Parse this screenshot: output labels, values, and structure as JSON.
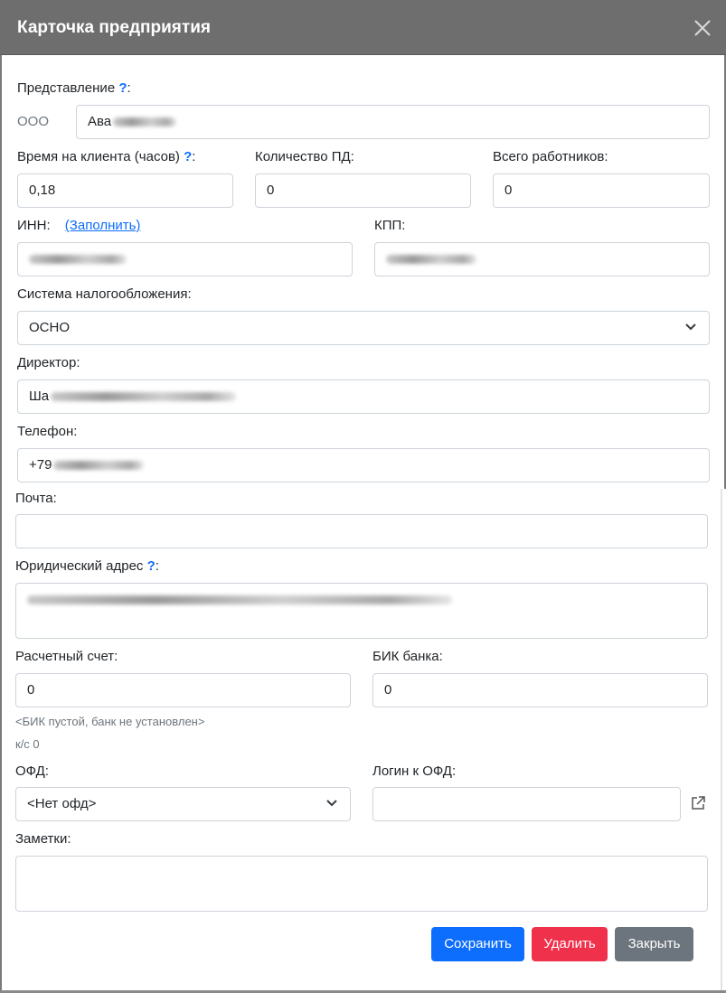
{
  "modal": {
    "title": "Карточка предприятия"
  },
  "fields": {
    "representation": {
      "label": "Представление",
      "help": "?",
      "colon": ":",
      "prefix": "ООО",
      "value": "Ава"
    },
    "client_time": {
      "label": "Время на клиента (часов)",
      "help": "?",
      "colon": ":",
      "value": "0,18"
    },
    "pd_count": {
      "label": "Количество ПД:",
      "value": "0"
    },
    "workers": {
      "label": "Всего работников:",
      "value": "0"
    },
    "inn": {
      "label": "ИНН:",
      "fill_link": "(Заполнить)",
      "value": ""
    },
    "kpp": {
      "label": "КПП:",
      "value": ""
    },
    "tax_system": {
      "label": "Система налогообложения:",
      "value": "ОСНО"
    },
    "director": {
      "label": "Директор:",
      "value": "Ша"
    },
    "phone": {
      "label": "Телефон:",
      "value": "+79"
    },
    "email": {
      "label": "Почта:",
      "value": ""
    },
    "legal_address": {
      "label": "Юридический адрес",
      "help": "?",
      "colon": ":",
      "value": ""
    },
    "account": {
      "label": "Расчетный счет:",
      "value": "0"
    },
    "bik": {
      "label": "БИК банка:",
      "value": "0"
    },
    "bank_status": "<БИК пустой, банк не установлен>",
    "corr_account": "к/с 0",
    "ofd": {
      "label": "ОФД:",
      "value": "<Нет офд>"
    },
    "ofd_login": {
      "label": "Логин к ОФД:",
      "value": ""
    },
    "notes": {
      "label": "Заметки:",
      "value": ""
    }
  },
  "buttons": {
    "save": "Сохранить",
    "delete": "Удалить",
    "close": "Закрыть"
  },
  "colors": {
    "header": "#6e6e6e",
    "primary": "#0d6efd",
    "danger": "#f0314c",
    "secondary": "#6c757d"
  }
}
